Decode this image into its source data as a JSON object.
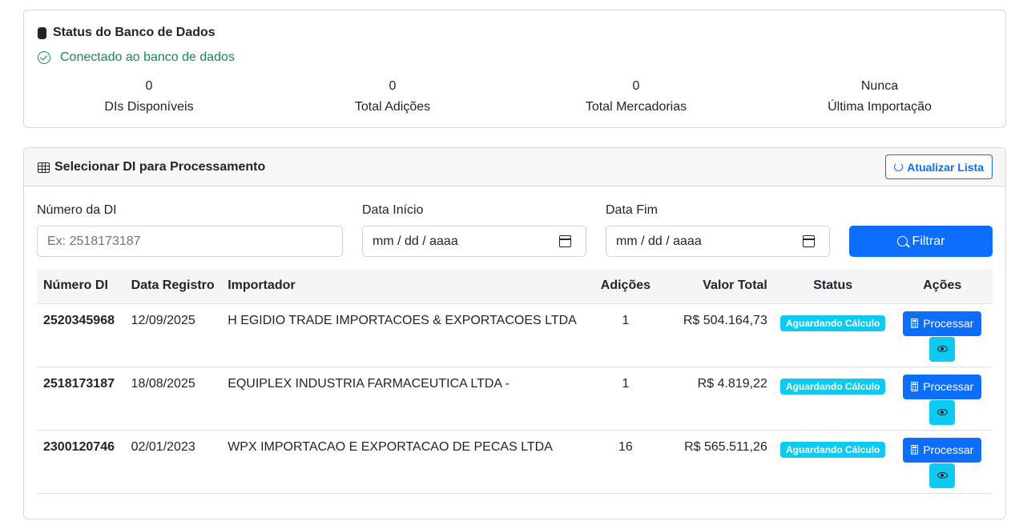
{
  "status": {
    "title": "Status do Banco de Dados",
    "connection": "Conectado ao banco de dados",
    "stats": [
      {
        "value": "0",
        "label": "DIs Disponíveis"
      },
      {
        "value": "0",
        "label": "Total Adições"
      },
      {
        "value": "0",
        "label": "Total Mercadorias"
      },
      {
        "value": "Nunca",
        "label": "Última Importação"
      }
    ]
  },
  "selection": {
    "title": "Selecionar DI para Processamento",
    "refresh_label": "Atualizar Lista",
    "filters": {
      "di_number_label": "Número da DI",
      "di_number_placeholder": "Ex: 2518173187",
      "start_date_label": "Data Início",
      "start_date_value": "mm / dd / aaaa",
      "end_date_label": "Data Fim",
      "end_date_value": "mm / dd / aaaa",
      "filter_label": "Filtrar"
    },
    "table": {
      "headers": [
        "Número DI",
        "Data Registro",
        "Importador",
        "Adições",
        "Valor Total",
        "Status",
        "Ações"
      ],
      "rows": [
        {
          "numero": "2520345968",
          "data": "12/09/2025",
          "importador": "H EGIDIO TRADE IMPORTACOES & EXPORTACOES LTDA",
          "adicoes": "1",
          "valor": "R$ 504.164,73",
          "status": "Aguardando Cálculo",
          "action": "Processar"
        },
        {
          "numero": "2518173187",
          "data": "18/08/2025",
          "importador": "EQUIPLEX INDUSTRIA FARMACEUTICA LTDA -",
          "adicoes": "1",
          "valor": "R$ 4.819,22",
          "status": "Aguardando Cálculo",
          "action": "Processar"
        },
        {
          "numero": "2300120746",
          "data": "02/01/2023",
          "importador": "WPX IMPORTACAO E EXPORTACAO DE PECAS LTDA",
          "adicoes": "16",
          "valor": "R$ 565.511,26",
          "status": "Aguardando Cálculo",
          "action": "Processar"
        }
      ]
    }
  },
  "colors": {
    "primary": "#0d6efd",
    "success": "#198754",
    "info": "#0dcaf0"
  },
  "icons": [
    "database-icon",
    "check-circle-icon",
    "table-icon",
    "refresh-icon",
    "calendar-icon",
    "search-icon",
    "calculator-icon",
    "eye-icon"
  ]
}
